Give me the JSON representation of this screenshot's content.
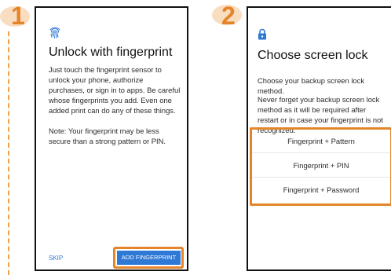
{
  "steps": [
    "1",
    "2"
  ],
  "screen1": {
    "icon": "fingerprint-icon",
    "title": "Unlock with fingerprint",
    "body": "Just touch the fingerprint sensor to unlock your phone, authorize purchases, or sign in to apps. Be careful whose fingerprints you add. Even one added print can do any of these things.",
    "note": "Note: Your fingerprint may be less secure than a strong pattern or PIN.",
    "skip_label": "SKIP",
    "add_label": "ADD FINGERPRINT"
  },
  "screen2": {
    "icon": "lock-icon",
    "title": "Choose screen lock",
    "body": "Choose your backup screen lock method.",
    "note": "Never forget your backup screen lock method as it will be required after restart or in case your fingerprint is not recognized.",
    "options": [
      "Fingerprint + Pattern",
      "Fingerprint + PIN",
      "Fingerprint + Password"
    ]
  },
  "colors": {
    "highlight": "#e4852a",
    "primary_button": "#2e78d6",
    "badge_bg": "#f7d7b5"
  }
}
